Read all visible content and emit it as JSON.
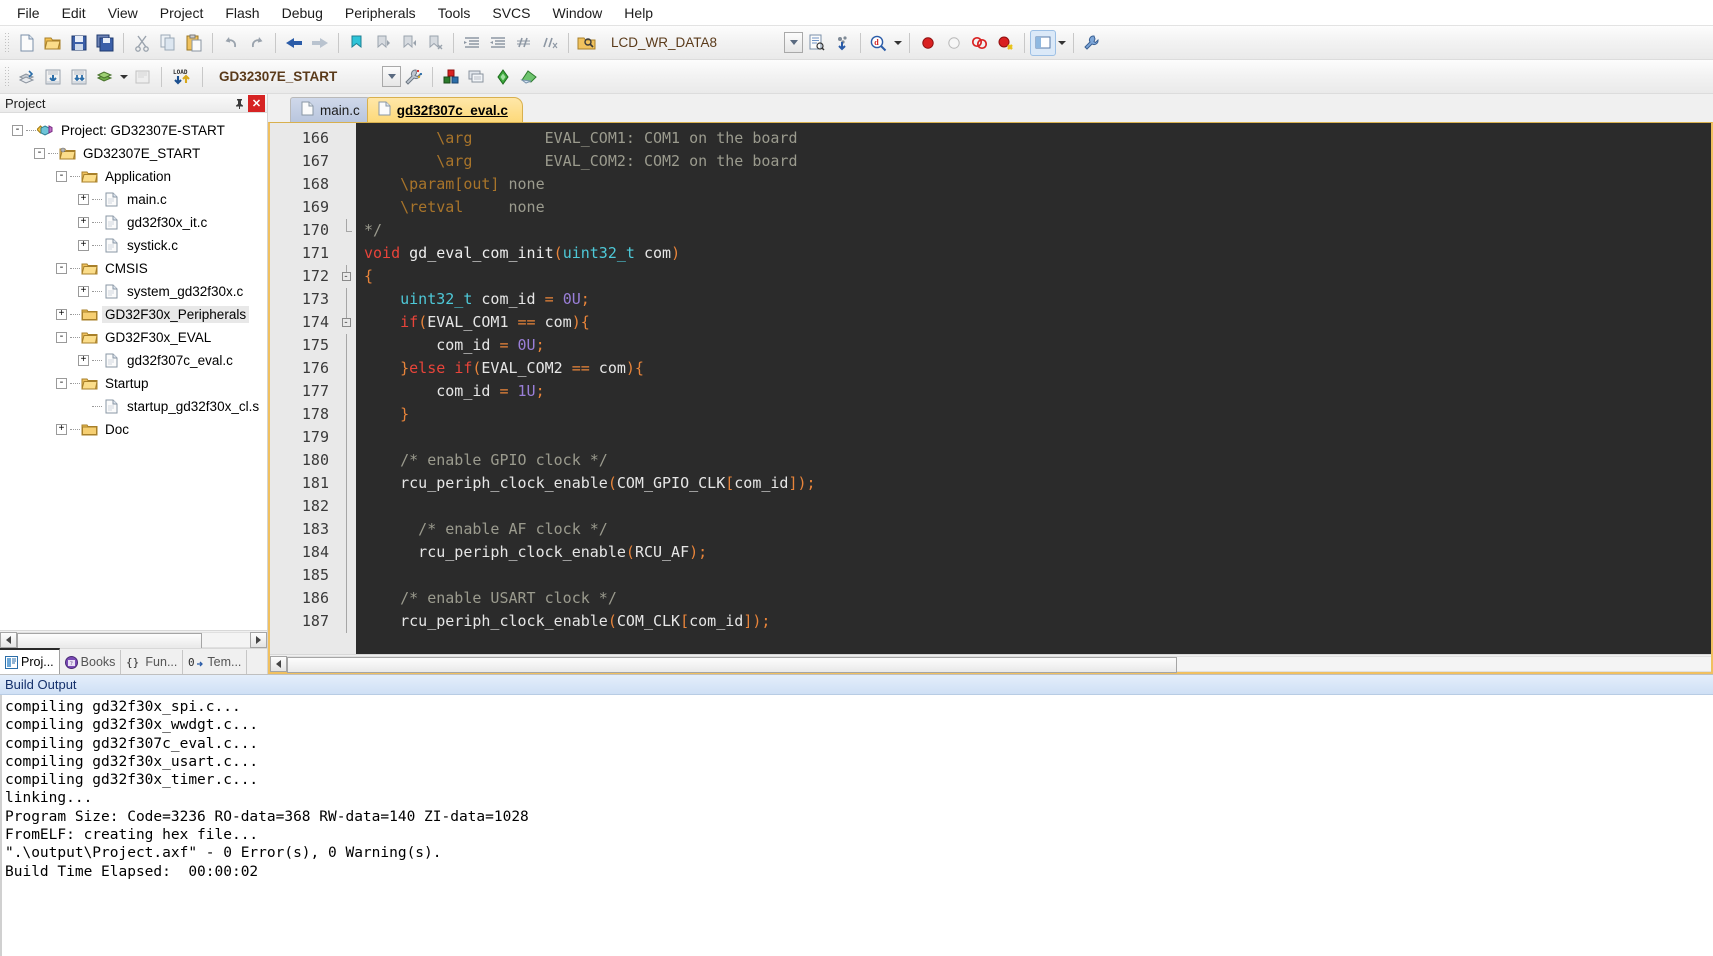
{
  "menu": {
    "items": [
      "File",
      "Edit",
      "View",
      "Project",
      "Flash",
      "Debug",
      "Peripherals",
      "Tools",
      "SVCS",
      "Window",
      "Help"
    ]
  },
  "toolbar1": {
    "icons": [
      "new-file-icon",
      "open-file-icon",
      "save-icon",
      "save-all-icon",
      "cut-icon",
      "copy-icon",
      "paste-icon",
      "undo-icon",
      "redo-icon",
      "navigate-back-icon",
      "navigate-forward-icon",
      "bookmark-toggle-icon",
      "bookmark-prev-icon",
      "bookmark-next-icon",
      "bookmark-clear-icon",
      "indent-icon",
      "outdent-icon",
      "comment-icon",
      "uncomment-icon",
      "find-in-files-icon",
      "config-wizard-icon",
      "insert-symbol-icon",
      "find-icon",
      "breakpoint-icon",
      "breakpoint-disable-icon",
      "breakpoint-list-icon",
      "breakpoint-kill-all-icon",
      "window-layout-icon",
      "build-settings-icon"
    ],
    "combo_value": "LCD_WR_DATA8"
  },
  "toolbar2": {
    "icons": [
      "translate-icon",
      "build-icon",
      "rebuild-icon",
      "batch-build-icon",
      "stop-build-icon",
      "download-icon",
      "target-options-icon",
      "manage-components-icon",
      "multi-project-icon",
      "debug-icon",
      "util-icon"
    ],
    "load_label": "LOAD",
    "target_value": "GD32307E_START"
  },
  "project_pane": {
    "title": "Project",
    "pin_icon": "pin-icon",
    "close_icon": "close-icon",
    "tree": [
      {
        "label": "Project: GD32307E-START",
        "indent": 0,
        "expander": "-",
        "icon": "project-icon",
        "selected": false
      },
      {
        "label": "GD32307E_START",
        "indent": 1,
        "expander": "-",
        "icon": "target-folder-icon",
        "selected": false
      },
      {
        "label": "Application",
        "indent": 2,
        "expander": "-",
        "icon": "folder-icon",
        "selected": false
      },
      {
        "label": "main.c",
        "indent": 3,
        "expander": "+",
        "icon": "c-file-icon",
        "selected": false
      },
      {
        "label": "gd32f30x_it.c",
        "indent": 3,
        "expander": "+",
        "icon": "c-file-icon",
        "selected": false
      },
      {
        "label": "systick.c",
        "indent": 3,
        "expander": "+",
        "icon": "c-file-icon",
        "selected": false
      },
      {
        "label": "CMSIS",
        "indent": 2,
        "expander": "-",
        "icon": "folder-icon",
        "selected": false
      },
      {
        "label": "system_gd32f30x.c",
        "indent": 3,
        "expander": "+",
        "icon": "c-file-icon",
        "selected": false
      },
      {
        "label": "GD32F30x_Peripherals",
        "indent": 2,
        "expander": "+",
        "icon": "folder-closed-icon",
        "selected": true
      },
      {
        "label": "GD32F30x_EVAL",
        "indent": 2,
        "expander": "-",
        "icon": "folder-icon",
        "selected": false
      },
      {
        "label": "gd32f307c_eval.c",
        "indent": 3,
        "expander": "+",
        "icon": "c-file-icon",
        "selected": false
      },
      {
        "label": "Startup",
        "indent": 2,
        "expander": "-",
        "icon": "folder-icon",
        "selected": false
      },
      {
        "label": "startup_gd32f30x_cl.s",
        "indent": 3,
        "expander": "",
        "icon": "asm-file-icon",
        "selected": false
      },
      {
        "label": "Doc",
        "indent": 2,
        "expander": "+",
        "icon": "folder-closed-icon",
        "selected": false
      }
    ],
    "bottom_tabs": [
      {
        "label": "Proj...",
        "icon": "project-window-icon",
        "active": true
      },
      {
        "label": "Books",
        "icon": "books-icon",
        "active": false
      },
      {
        "label": "Fun...",
        "icon": "functions-icon",
        "active": false
      },
      {
        "label": "Tem...",
        "icon": "templates-icon",
        "active": false
      }
    ]
  },
  "editor": {
    "tabs": [
      {
        "label": "main.c",
        "icon": "file-icon",
        "active": false
      },
      {
        "label": "gd32f307c_eval.c",
        "icon": "file-icon",
        "active": true
      }
    ],
    "first_line": 166,
    "lines": [
      {
        "n": 166,
        "fold": "",
        "tokens": [
          {
            "t": "        ",
            "c": "c-cmt"
          },
          {
            "t": "\\arg",
            "c": "c-doc"
          },
          {
            "t": "        EVAL_COM1: COM1 on the board",
            "c": "c-cmt"
          }
        ]
      },
      {
        "n": 167,
        "fold": "",
        "tokens": [
          {
            "t": "        ",
            "c": "c-cmt"
          },
          {
            "t": "\\arg",
            "c": "c-doc"
          },
          {
            "t": "        EVAL_COM2: COM2 on the board",
            "c": "c-cmt"
          }
        ]
      },
      {
        "n": 168,
        "fold": "",
        "tokens": [
          {
            "t": "    ",
            "c": "c-cmt"
          },
          {
            "t": "\\param[out]",
            "c": "c-doc"
          },
          {
            "t": " none",
            "c": "c-cmt"
          }
        ]
      },
      {
        "n": 169,
        "fold": "",
        "tokens": [
          {
            "t": "    ",
            "c": "c-cmt"
          },
          {
            "t": "\\retval",
            "c": "c-doc"
          },
          {
            "t": "     none",
            "c": "c-cmt"
          }
        ]
      },
      {
        "n": 170,
        "fold": "end",
        "tokens": [
          {
            "t": "*/",
            "c": "c-cmt"
          }
        ]
      },
      {
        "n": 171,
        "fold": "",
        "tokens": [
          {
            "t": "void",
            "c": "c-kw"
          },
          {
            "t": " gd_eval_com_init",
            "c": "c-fn"
          },
          {
            "t": "(",
            "c": "c-op"
          },
          {
            "t": "uint32_t",
            "c": "c-type"
          },
          {
            "t": " com",
            "c": "c-id"
          },
          {
            "t": ")",
            "c": "c-op"
          }
        ]
      },
      {
        "n": 172,
        "fold": "start",
        "tokens": [
          {
            "t": "{",
            "c": "c-op"
          }
        ]
      },
      {
        "n": 173,
        "fold": "bar",
        "tokens": [
          {
            "t": "    ",
            "c": "c-id"
          },
          {
            "t": "uint32_t",
            "c": "c-type"
          },
          {
            "t": " com_id ",
            "c": "c-id"
          },
          {
            "t": "=",
            "c": "c-op"
          },
          {
            "t": " ",
            "c": "c-id"
          },
          {
            "t": "0U",
            "c": "c-num"
          },
          {
            "t": ";",
            "c": "c-op"
          }
        ]
      },
      {
        "n": 174,
        "fold": "start",
        "tokens": [
          {
            "t": "    ",
            "c": "c-id"
          },
          {
            "t": "if",
            "c": "c-kw"
          },
          {
            "t": "(",
            "c": "c-op"
          },
          {
            "t": "EVAL_COM1 ",
            "c": "c-id"
          },
          {
            "t": "==",
            "c": "c-op"
          },
          {
            "t": " com",
            "c": "c-id"
          },
          {
            "t": "){",
            "c": "c-op"
          }
        ]
      },
      {
        "n": 175,
        "fold": "bar2",
        "tokens": [
          {
            "t": "        com_id ",
            "c": "c-id"
          },
          {
            "t": "=",
            "c": "c-op"
          },
          {
            "t": " ",
            "c": "c-id"
          },
          {
            "t": "0U",
            "c": "c-num"
          },
          {
            "t": ";",
            "c": "c-op"
          }
        ]
      },
      {
        "n": 176,
        "fold": "bar2",
        "tokens": [
          {
            "t": "    ",
            "c": "c-id"
          },
          {
            "t": "}",
            "c": "c-op"
          },
          {
            "t": "else",
            "c": "c-kw"
          },
          {
            "t": " ",
            "c": "c-id"
          },
          {
            "t": "if",
            "c": "c-kw"
          },
          {
            "t": "(",
            "c": "c-op"
          },
          {
            "t": "EVAL_COM2 ",
            "c": "c-id"
          },
          {
            "t": "==",
            "c": "c-op"
          },
          {
            "t": " com",
            "c": "c-id"
          },
          {
            "t": "){",
            "c": "c-op"
          }
        ]
      },
      {
        "n": 177,
        "fold": "bar2",
        "tokens": [
          {
            "t": "        com_id ",
            "c": "c-id"
          },
          {
            "t": "=",
            "c": "c-op"
          },
          {
            "t": " ",
            "c": "c-id"
          },
          {
            "t": "1U",
            "c": "c-num"
          },
          {
            "t": ";",
            "c": "c-op"
          }
        ]
      },
      {
        "n": 178,
        "fold": "bar2",
        "tokens": [
          {
            "t": "    ",
            "c": "c-id"
          },
          {
            "t": "}",
            "c": "c-op"
          }
        ]
      },
      {
        "n": 179,
        "fold": "bar",
        "tokens": [
          {
            "t": "",
            "c": "c-id"
          }
        ]
      },
      {
        "n": 180,
        "fold": "bar",
        "tokens": [
          {
            "t": "    /* enable GPIO clock */",
            "c": "c-cmt"
          }
        ]
      },
      {
        "n": 181,
        "fold": "bar",
        "tokens": [
          {
            "t": "    rcu_periph_clock_enable",
            "c": "c-id"
          },
          {
            "t": "(",
            "c": "c-op"
          },
          {
            "t": "COM_GPIO_CLK",
            "c": "c-id"
          },
          {
            "t": "[",
            "c": "c-op"
          },
          {
            "t": "com_id",
            "c": "c-id"
          },
          {
            "t": "]);",
            "c": "c-op"
          }
        ]
      },
      {
        "n": 182,
        "fold": "bar",
        "tokens": [
          {
            "t": "",
            "c": "c-id"
          }
        ]
      },
      {
        "n": 183,
        "fold": "bar",
        "tokens": [
          {
            "t": "      /* enable AF clock */",
            "c": "c-cmt"
          }
        ]
      },
      {
        "n": 184,
        "fold": "bar",
        "tokens": [
          {
            "t": "      rcu_periph_clock_enable",
            "c": "c-id"
          },
          {
            "t": "(",
            "c": "c-op"
          },
          {
            "t": "RCU_AF",
            "c": "c-id"
          },
          {
            "t": ");",
            "c": "c-op"
          }
        ]
      },
      {
        "n": 185,
        "fold": "bar",
        "tokens": [
          {
            "t": "",
            "c": "c-id"
          }
        ]
      },
      {
        "n": 186,
        "fold": "bar",
        "tokens": [
          {
            "t": "    /* enable USART clock */",
            "c": "c-cmt"
          }
        ]
      },
      {
        "n": 187,
        "fold": "bar",
        "tokens": [
          {
            "t": "    rcu_periph_clock_enable",
            "c": "c-id"
          },
          {
            "t": "(",
            "c": "c-op"
          },
          {
            "t": "COM_CLK",
            "c": "c-id"
          },
          {
            "t": "[",
            "c": "c-op"
          },
          {
            "t": "com_id",
            "c": "c-id"
          },
          {
            "t": "]);",
            "c": "c-op"
          }
        ]
      }
    ]
  },
  "build_output": {
    "title": "Build Output",
    "lines": [
      "compiling gd32f30x_spi.c...",
      "compiling gd32f30x_wwdgt.c...",
      "compiling gd32f307c_eval.c...",
      "compiling gd32f30x_usart.c...",
      "compiling gd32f30x_timer.c...",
      "linking...",
      "Program Size: Code=3236 RO-data=368 RW-data=140 ZI-data=1028",
      "FromELF: creating hex file...",
      "\".\\output\\Project.axf\" - 0 Error(s), 0 Warning(s).",
      "Build Time Elapsed:  00:00:02"
    ]
  },
  "colors": {
    "accent_tab": "#fdd97a",
    "editor_bg": "#2b2b2b",
    "selection": "#e8e8e8",
    "build_header": "#cfe0f5"
  }
}
